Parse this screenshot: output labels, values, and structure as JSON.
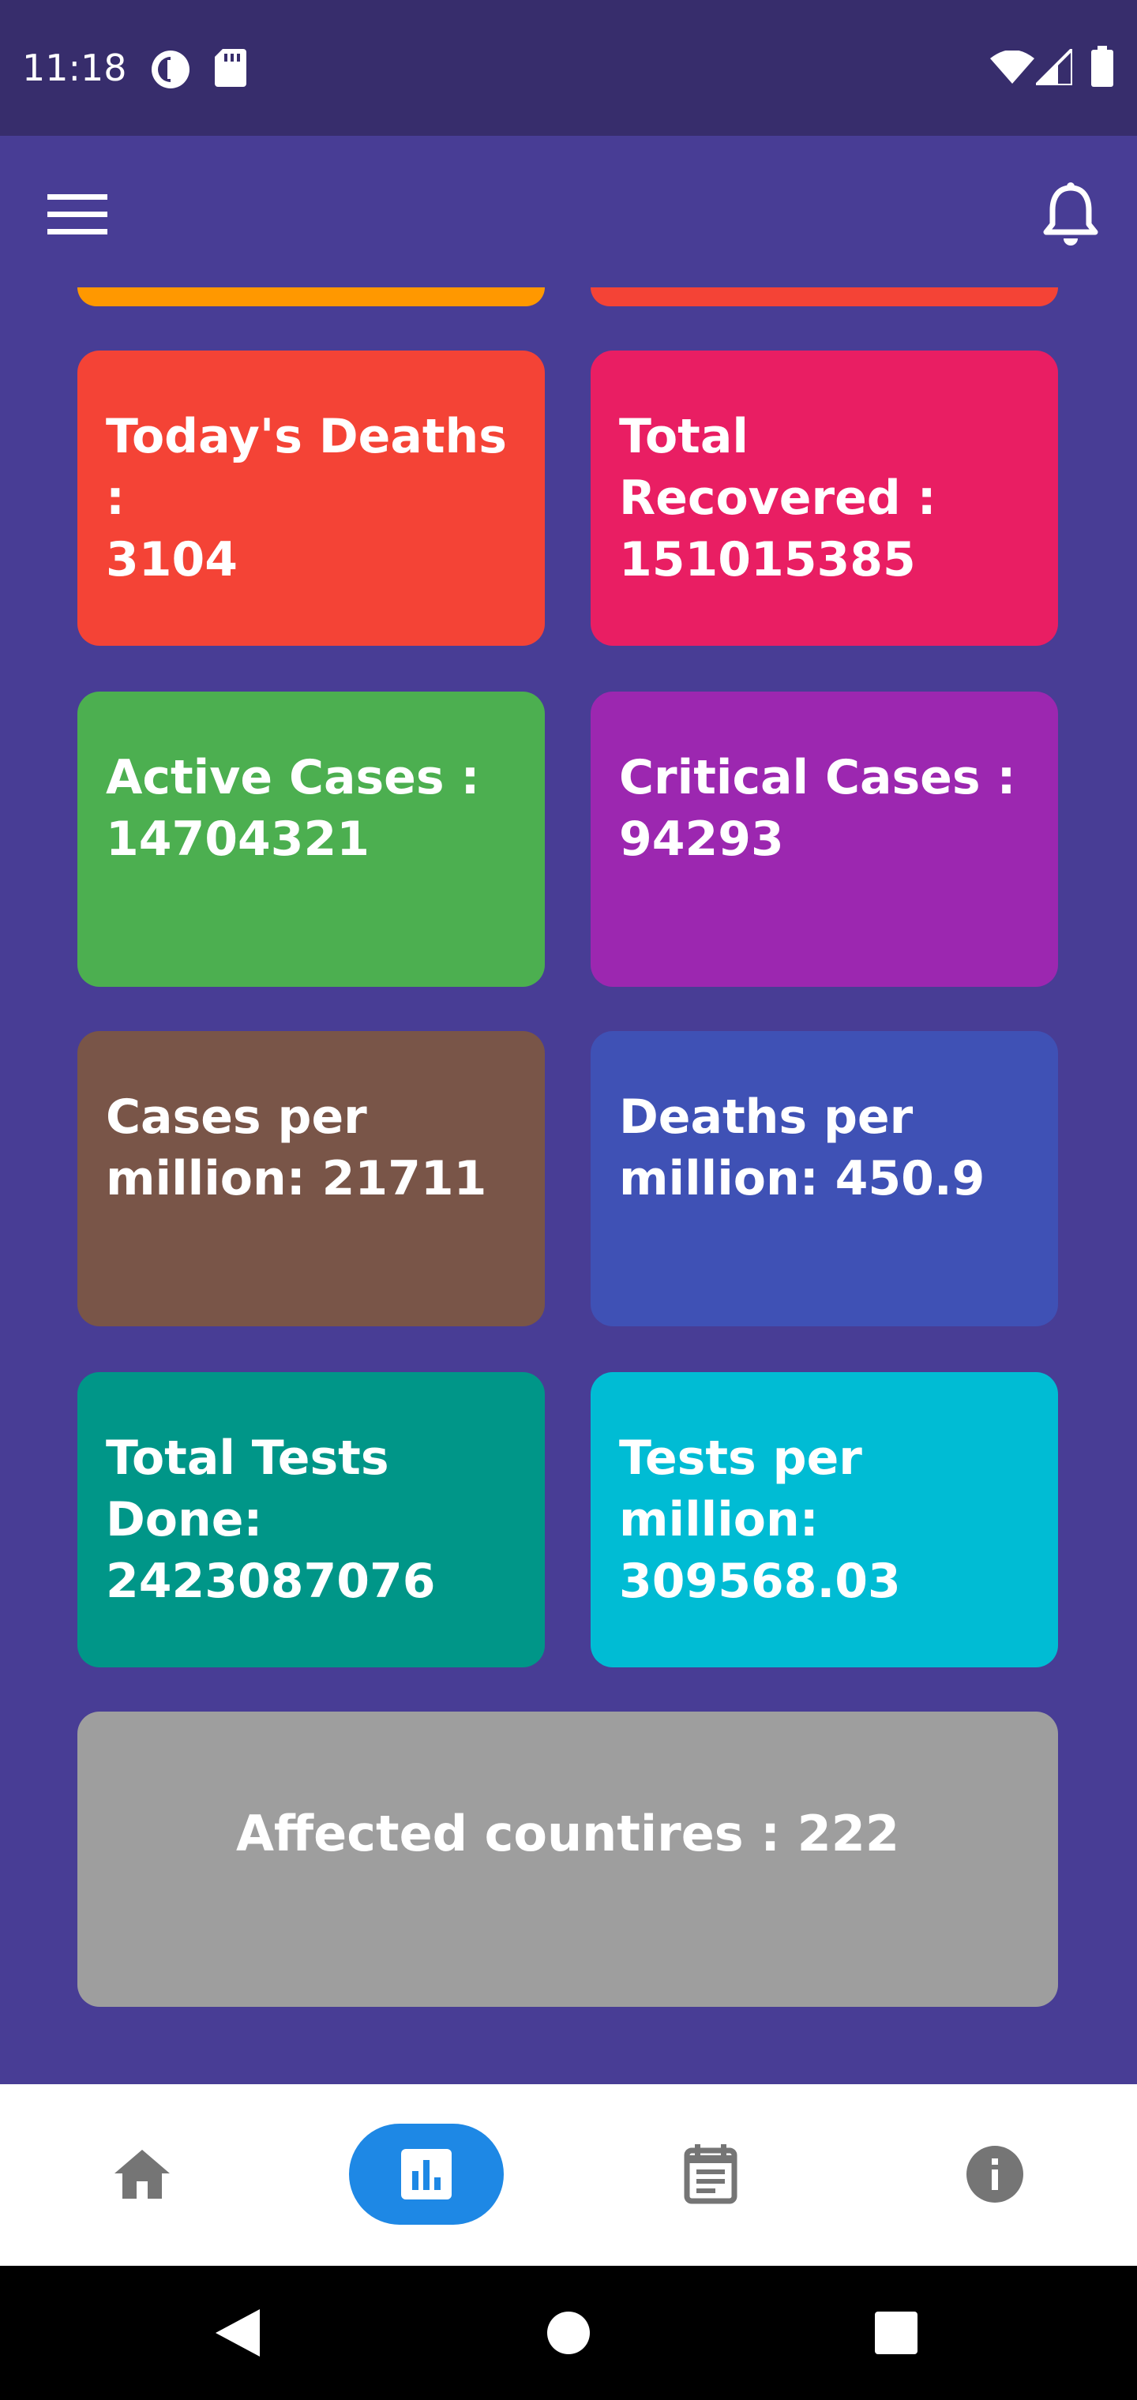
{
  "status_bar": {
    "time": "11:18",
    "icons": [
      "data-saver-icon",
      "sd-card-icon",
      "wifi-icon",
      "signal-icon",
      "battery-icon"
    ]
  },
  "app_bar": {
    "menu_icon": "menu-icon",
    "notification_icon": "bell-icon"
  },
  "colors": {
    "background": "#483D95",
    "status_bar": "#372D6C",
    "orange": "#FF9800",
    "red": "#F44336",
    "pink": "#E91E63",
    "green": "#4CAF50",
    "purple": "#9C27B0",
    "brown": "#795548",
    "indigo": "#3F51B5",
    "teal": "#009688",
    "cyan": "#00BCD4",
    "grey": "#9E9E9E",
    "nav_active": "#1E88E5"
  },
  "stats": {
    "todays_deaths": {
      "label": "Today's Deaths :",
      "value": "3104"
    },
    "total_recovered": {
      "label": "Total Recovered :",
      "value": "151015385"
    },
    "active_cases": {
      "label": "Active Cases :",
      "value": "14704321"
    },
    "critical_cases": {
      "label": "Critical Cases :",
      "value": "94293"
    },
    "cases_per_million": {
      "label": "Cases per",
      "value": "million: 21711"
    },
    "deaths_per_million": {
      "label": "Deaths per",
      "value": "million: 450.9"
    },
    "total_tests": {
      "label": "Total Tests Done:",
      "value": "2423087076"
    },
    "tests_per_million": {
      "label": "Tests per million:",
      "value": "309568.03"
    },
    "affected_countries": "Affected countires : 222"
  },
  "bottom_nav": {
    "items": [
      "home-icon",
      "bar-chart-icon",
      "calendar-icon",
      "info-icon"
    ],
    "active_index": 1
  },
  "system_nav": {
    "items": [
      "back-icon",
      "home-circle-icon",
      "recents-icon"
    ]
  }
}
